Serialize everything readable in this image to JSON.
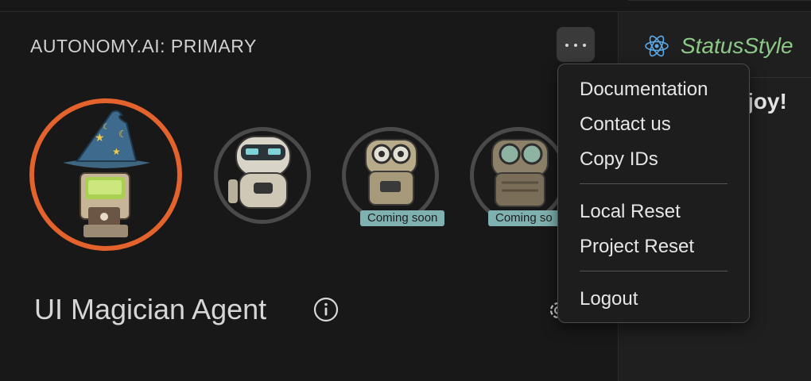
{
  "panel": {
    "title": "AUTONOMY.AI: PRIMARY",
    "agent_name": "UI Magician Agent"
  },
  "avatars": [
    {
      "name": "wizard-robot",
      "selected": true,
      "badge": ""
    },
    {
      "name": "visor-robot",
      "selected": false,
      "badge": ""
    },
    {
      "name": "camera-robot",
      "selected": false,
      "badge": "Coming soon"
    },
    {
      "name": "goggles-robot",
      "selected": false,
      "badge": "Coming so"
    }
  ],
  "editor": {
    "tab_title": "StatusStyle",
    "content_text": "joy!"
  },
  "menu": {
    "items": [
      "Documentation",
      "Contact us",
      "Copy IDs",
      "Local Reset",
      "Project Reset",
      "Logout"
    ]
  },
  "icons": {
    "more": "more-horizontal-icon",
    "info": "info-icon",
    "settings": "gear-icon",
    "react": "react-icon"
  },
  "colors": {
    "selected_ring": "#e4622b",
    "badge_bg": "#7fb1b0",
    "accent_text": "#8cc987"
  }
}
